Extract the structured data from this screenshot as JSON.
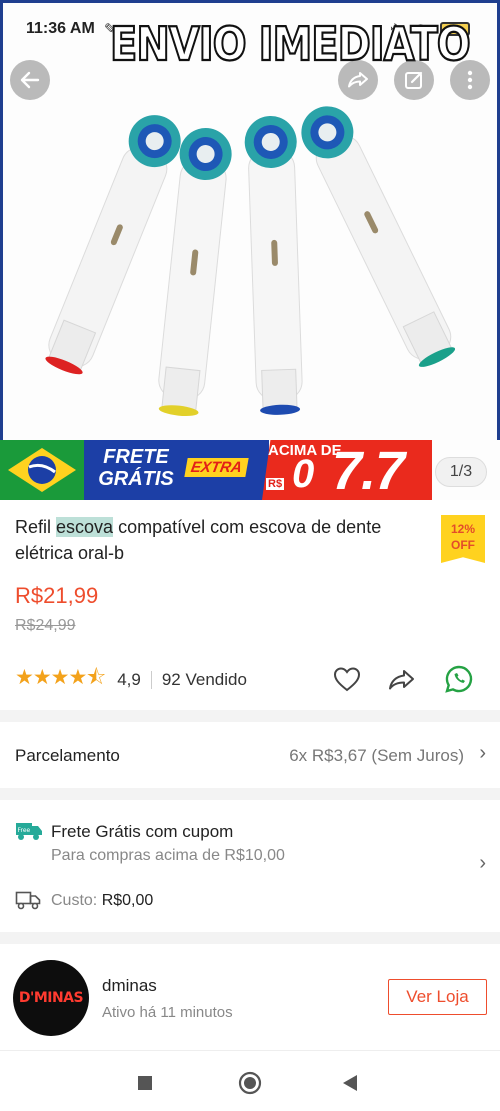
{
  "status_bar": {
    "time": "11:36 AM",
    "battery": "75"
  },
  "promo_overlay": {
    "text": "ENVIO IMEDIATO"
  },
  "top_actions": {
    "icons": [
      "back-arrow-icon",
      "share-icon",
      "edit-icon",
      "more-icon"
    ]
  },
  "banner": {
    "frete": "FRETE GRÁTIS",
    "extra": "EXTRA",
    "acima": "ACIMA DE",
    "rs": "R$",
    "zero": "0",
    "amount": "7.7"
  },
  "image_counter": "1/3",
  "product": {
    "title_pre": "Refil ",
    "title_highlight": "escova",
    "title_post": " compatível com escova de dente elétrica oral-b",
    "discount_percent": "12%",
    "discount_label": "OFF",
    "price": "R$21,99",
    "old_price": "R$24,99",
    "rating": "4,9",
    "rating_stars": 4.9,
    "sold": "92 Vendido"
  },
  "installments": {
    "label": "Parcelamento",
    "value": "6x R$3,67 (Sem Juros)"
  },
  "shipping": {
    "title": "Frete Grátis com cupom",
    "subtitle": "Para compras acima de R$10,00",
    "cost_label": "Custo:",
    "cost_value": "R$0,00",
    "badge": "Free"
  },
  "shop": {
    "logo_text": "D'MINAS",
    "name": "dminas",
    "active": "Ativo há 11 minutos",
    "button": "Ver Loja"
  },
  "colors": {
    "accent": "#ee4d2d",
    "star": "#f3a21b",
    "whatsapp": "#25a244"
  }
}
